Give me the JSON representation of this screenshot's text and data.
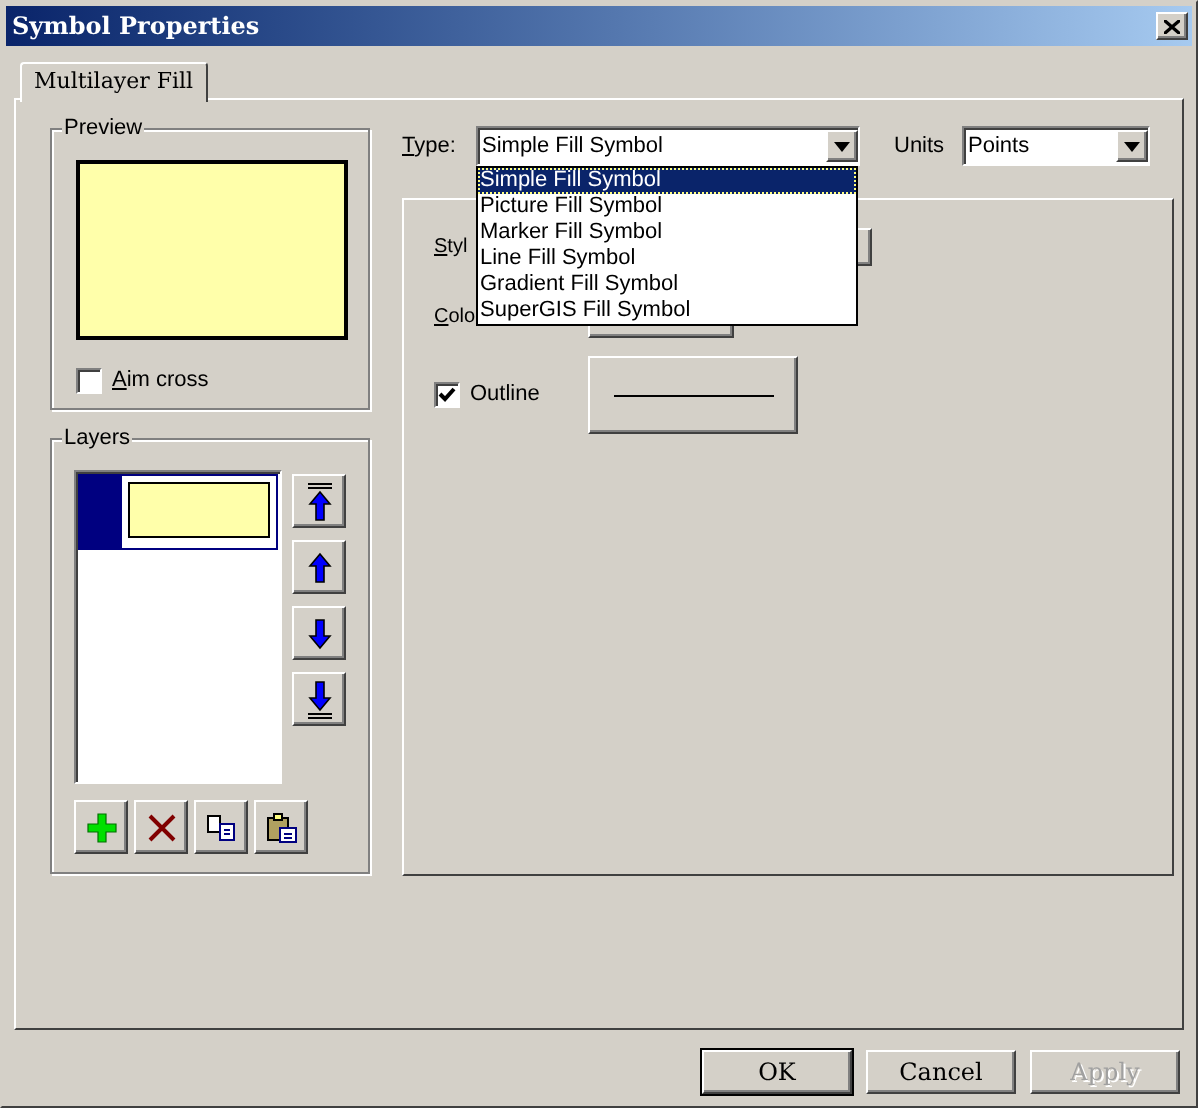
{
  "window": {
    "title": "Symbol Properties"
  },
  "tabs": [
    {
      "label": "Multilayer Fill",
      "selected": true
    }
  ],
  "preview": {
    "title": "Preview",
    "aim_cross": {
      "label": "Aim cross",
      "checked": false
    }
  },
  "layers": {
    "title": "Layers",
    "items": [
      {
        "selected": true
      }
    ]
  },
  "type": {
    "label": "Type:",
    "value": "Simple Fill Symbol",
    "expanded": true,
    "options": [
      {
        "label": "Simple Fill Symbol",
        "selected": true
      },
      {
        "label": "Picture Fill Symbol",
        "selected": false
      },
      {
        "label": "Marker Fill Symbol",
        "selected": false
      },
      {
        "label": "Line Fill Symbol",
        "selected": false
      },
      {
        "label": "Gradient Fill Symbol",
        "selected": false
      },
      {
        "label": "SuperGIS Fill Symbol",
        "selected": false
      }
    ]
  },
  "units": {
    "label": "Units",
    "value": "Points"
  },
  "style": {
    "label": "Styl"
  },
  "color": {
    "label": "Colo"
  },
  "outline": {
    "label": "Outline",
    "checked": true
  },
  "buttons": [
    {
      "label": "OK",
      "default": true,
      "disabled": false
    },
    {
      "label": "Cancel",
      "default": false,
      "disabled": false
    },
    {
      "label": "Apply",
      "default": false,
      "disabled": true
    }
  ]
}
